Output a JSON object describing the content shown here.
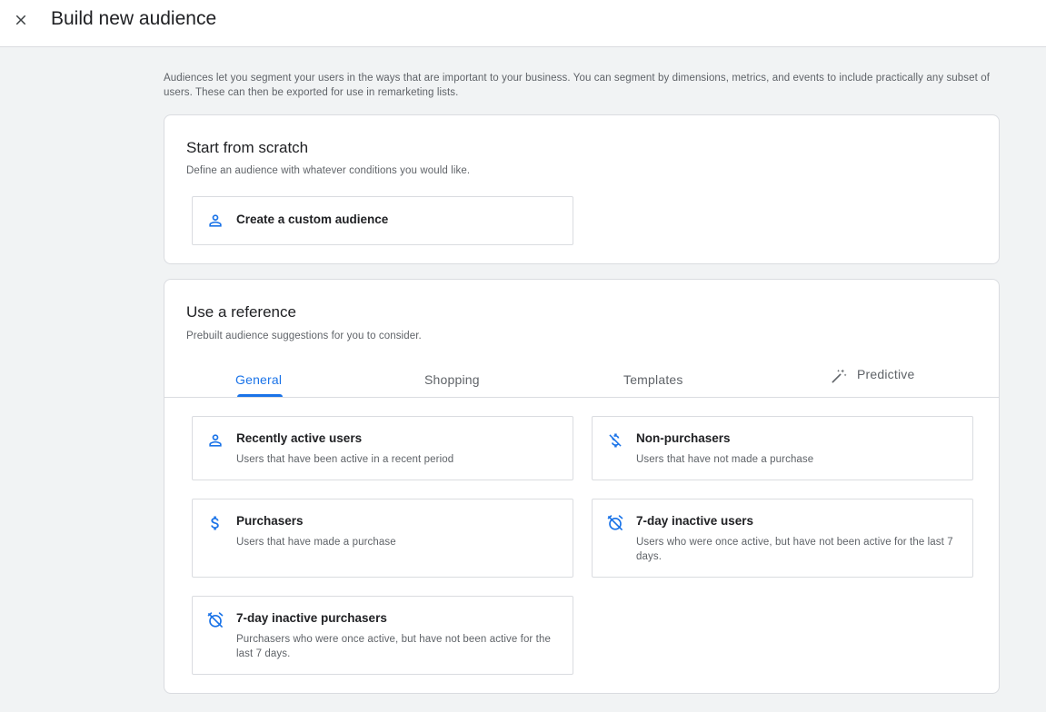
{
  "header": {
    "title": "Build new audience"
  },
  "intro": {
    "text": "Audiences let you segment your users in the ways that are important to your business. You can segment by dimensions, metrics, and events to include practically any subset of users. These can then be exported for use in remarketing lists."
  },
  "scratch": {
    "title": "Start from scratch",
    "subtitle": "Define an audience with whatever conditions you would like.",
    "custom_option": {
      "label": "Create a custom audience",
      "icon": "person-icon"
    }
  },
  "reference": {
    "title": "Use a reference",
    "subtitle": "Prebuilt audience suggestions for you to consider.",
    "tabs": [
      {
        "label": "General",
        "active": true
      },
      {
        "label": "Shopping"
      },
      {
        "label": "Templates"
      },
      {
        "label": "Predictive",
        "icon": "magic-wand-icon"
      }
    ],
    "options": [
      {
        "title": "Recently active users",
        "desc": "Users that have been active in a recent period",
        "icon": "person-icon"
      },
      {
        "title": "Non-purchasers",
        "desc": "Users that have not made a purchase",
        "icon": "money-off-icon"
      },
      {
        "title": "Purchasers",
        "desc": "Users that have made a purchase",
        "icon": "dollar-icon"
      },
      {
        "title": "7-day inactive users",
        "desc": "Users who were once active, but have not been active for the last 7 days.",
        "icon": "alarm-off-icon"
      },
      {
        "title": "7-day inactive purchasers",
        "desc": "Purchasers who were once active, but have not been active for the last 7 days.",
        "icon": "alarm-off-icon"
      }
    ]
  },
  "colors": {
    "accent": "#1a73e8",
    "border": "#dadce0",
    "background": "#f1f3f4"
  }
}
